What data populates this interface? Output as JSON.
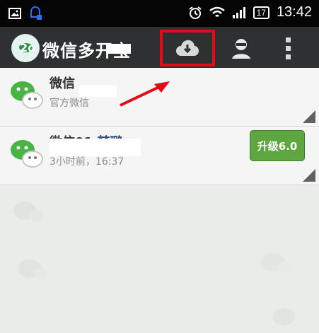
{
  "status_bar": {
    "time": "13:42",
    "battery": "17",
    "icons": [
      "image-icon",
      "notification-icon",
      "alarm-icon",
      "wifi-icon",
      "signal-icon",
      "battery-icon"
    ]
  },
  "app_bar": {
    "title": "微信多开宝",
    "download_icon": "download-icon",
    "account_icon": "account-icon",
    "overflow_icon": "overflow-menu-icon",
    "highlight_color": "#e10d16"
  },
  "list": [
    {
      "title": "微信",
      "subtitle": "官方微信",
      "icon": "wechat-icon"
    },
    {
      "title_prefix": "微信01",
      "title_name": "梦璐",
      "subtitle": "3小时前，16:37",
      "icon": "wechat-icon",
      "action": "升级6.0"
    }
  ],
  "colors": {
    "status_bar": "#050505",
    "app_bar": "#2f3032",
    "accent_green": "#5ea640"
  }
}
